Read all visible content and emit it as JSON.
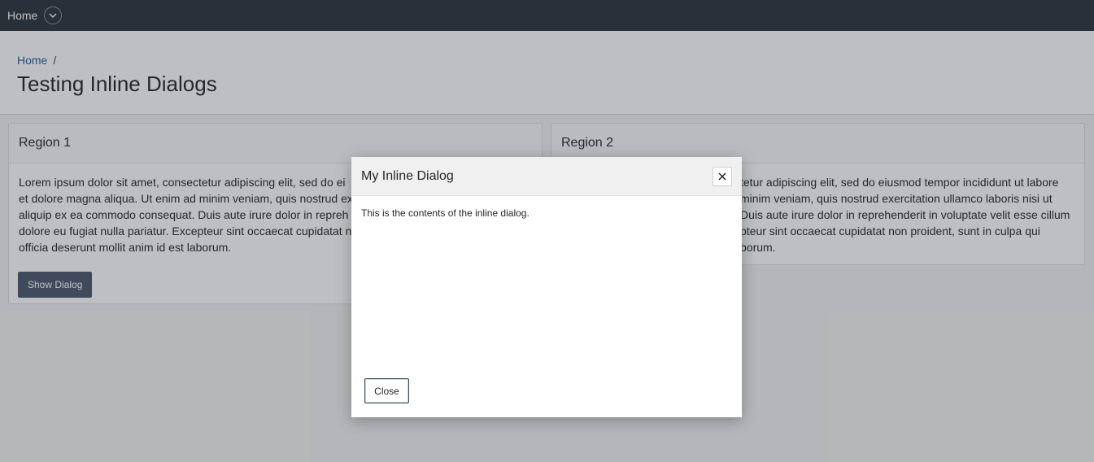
{
  "nav": {
    "home_label": "Home",
    "menu_icon": "chevron-down-icon"
  },
  "breadcrumb": {
    "home": "Home",
    "separator": "/"
  },
  "page": {
    "title": "Testing Inline Dialogs"
  },
  "regions": [
    {
      "title": "Region 1",
      "lines": [
        "Lorem ipsum dolor sit amet, consectetur adipiscing elit, sed do ei",
        "et dolore magna aliqua. Ut enim ad minim veniam, quis nostrud ex",
        "aliquip ex ea commodo consequat. Duis aute irure dolor in repreh",
        "dolore eu fugiat nulla pariatur. Excepteur sint occaecat cupidatat n",
        "officia deserunt mollit anim id est laborum."
      ],
      "button_label": "Show Dialog"
    },
    {
      "title": "Region 2",
      "lines": [
        "tetur adipiscing elit, sed do eiusmod tempor incididunt ut labore",
        "minim veniam, quis nostrud exercitation ullamco laboris nisi ut",
        "Duis aute irure dolor in reprehenderit in voluptate velit esse cillum",
        "pteur sint occaecat cupidatat non proident, sunt in culpa qui",
        "borum."
      ]
    }
  ],
  "dialog": {
    "title": "My Inline Dialog",
    "close_icon": "close-icon",
    "body": "This is the contents of the inline dialog.",
    "close_button": "Close"
  },
  "colors": {
    "topbar": "#2c333d",
    "link": "#1a62a7",
    "button": "#4a5a6e",
    "overlay": "rgba(40,44,52,0.3)"
  }
}
